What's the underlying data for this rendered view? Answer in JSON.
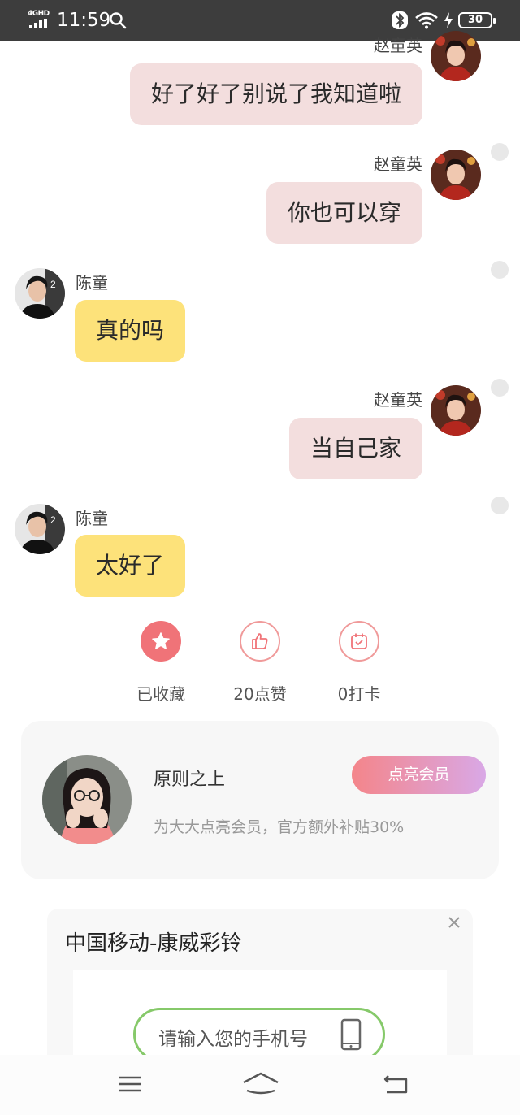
{
  "status_bar": {
    "network": "4GHD",
    "time": "11:59",
    "battery": "30"
  },
  "chat": {
    "messages": [
      {
        "side": "right",
        "sender": "赵童英",
        "text": "好了好了别说了我知道啦"
      },
      {
        "side": "right",
        "sender": "赵童英",
        "text": "你也可以穿"
      },
      {
        "side": "left",
        "sender": "陈童",
        "text": "真的吗"
      },
      {
        "side": "right",
        "sender": "赵童英",
        "text": "当自己家"
      },
      {
        "side": "left",
        "sender": "陈童",
        "text": "太好了"
      }
    ]
  },
  "actions": {
    "favorite_label": "已收藏",
    "like_label": "20点赞",
    "checkin_label": "0打卡"
  },
  "member_card": {
    "name": "原则之上",
    "description": "为大大点亮会员，官方额外补贴30%",
    "button_label": "点亮会员"
  },
  "ad": {
    "title": "中国移动-康威彩铃",
    "input_placeholder": "请输入您的手机号"
  },
  "colors": {
    "status_bar": "#3d3d3d",
    "right_bubble": "#f3dede",
    "left_bubble": "#fde27a",
    "favorite_accent": "#f07378",
    "member_button_gradient_start": "#f4858a",
    "member_button_gradient_end": "#d9a8e6",
    "ad_input_border": "#86c96a"
  }
}
